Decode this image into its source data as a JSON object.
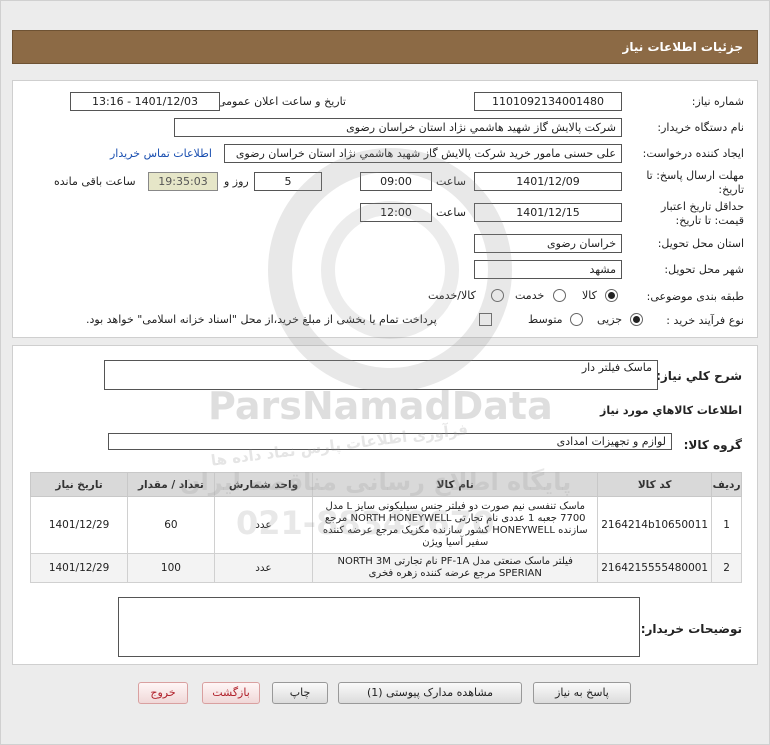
{
  "page": {
    "title": "جزئیات اطلاعات نیاز"
  },
  "form": {
    "need_number_label": "شماره نیاز:",
    "need_number": "1101092134001480",
    "announce_label": "تاریخ و ساعت اعلان عمومی:",
    "announce_value": "1401/12/03 - 13:16",
    "buyer_label": "نام دستگاه خریدار:",
    "buyer_value": "شرکت پالایش گاز شهید هاشمي نژاد   استان خراسان رضوی",
    "creator_label": "ایجاد کننده درخواست:",
    "creator_value": "علی حسنی مامور خرید شرکت پالایش گاز شهید هاشمي نژاد   استان خراسان رضوی",
    "contact_link": "اطلاعات تماس خریدار",
    "deadline_label_1": "مهلت ارسال پاسخ: تا",
    "deadline_label_2": "تاریخ:",
    "deadline_date": "1401/12/09",
    "time_label": "ساعت",
    "deadline_time": "09:00",
    "days_value": "5",
    "days_label": "روز و",
    "remaining_time": "19:35:03",
    "remaining_label": "ساعت باقی مانده",
    "validity_label_1": "حداقل تاریخ اعتبار",
    "validity_label_2": "قیمت: تا تاریخ:",
    "validity_date": "1401/12/15",
    "validity_time": "12:00",
    "province_label": "استان محل تحویل:",
    "province_value": "خراسان رضوی",
    "city_label": "شهر محل تحویل:",
    "city_value": "مشهد",
    "category_label": "طبقه بندی موضوعی:",
    "category_options": [
      "کالا",
      "خدمت",
      "کالا/خدمت"
    ],
    "process_label": "نوع فرآیند خرید :",
    "process_options": [
      "جزیی",
      "متوسط"
    ],
    "payment_note": "پرداخت تمام یا بخشی از مبلغ خرید،از محل \"اسناد خزانه اسلامی\" خواهد بود."
  },
  "details": {
    "summary_label": "شرح کلي نیاز:",
    "summary_value": "ماسک فیلتر دار",
    "items_heading": "اطلاعات کالاهاي مورد نیاز",
    "group_label": "گروه کالا:",
    "group_value": "لوازم و تجهیزات امدادی",
    "table": {
      "headers": [
        "ردیف",
        "کد کالا",
        "نام کالا",
        "واحد شمارش",
        "تعداد / مقدار",
        "تاریخ نیاز"
      ],
      "rows": [
        {
          "idx": "1",
          "code": "2164214b10650011",
          "name": "ماسک تنفسی نیم صورت دو فیلتر جنس سیلیکونی سایز L مدل 7700 جعبه 1 عددی نام تجارتی NORTH HONEYWELL مرجع سازنده HONEYWELL کشور سازنده مکزیک مرجع عرضه کننده سفیر آسیا ویژن",
          "unit": "عدد",
          "qty": "60",
          "date": "1401/12/29"
        },
        {
          "idx": "2",
          "code": "2164215555480001",
          "name": "فیلتر ماسک صنعتی مدل PF-1A نام تجارتی NORTH 3M SPERIAN مرجع عرضه کننده زهره فخری",
          "unit": "عدد",
          "qty": "100",
          "date": "1401/12/29"
        }
      ]
    },
    "buyer_notes_label": "توضیحات خریدار:",
    "buyer_notes_value": ""
  },
  "buttons": {
    "reply": "پاسخ به نیاز",
    "attachments": "مشاهده مدارک پیوستی (1)",
    "print": "چاپ",
    "back": "بازگشت",
    "exit": "خروج"
  },
  "watermark": {
    "brand": "ParsNamadData",
    "line1": "پایگاه اطلاع رسانی مناقصه ایران",
    "line2": "فرآوری اطلاعات پارس نماد داده ها",
    "phone": "021-88349670"
  },
  "colors": {
    "title_bar": "#8c6a45",
    "link": "#1a4fb0",
    "exit_text": "#b0202a"
  }
}
